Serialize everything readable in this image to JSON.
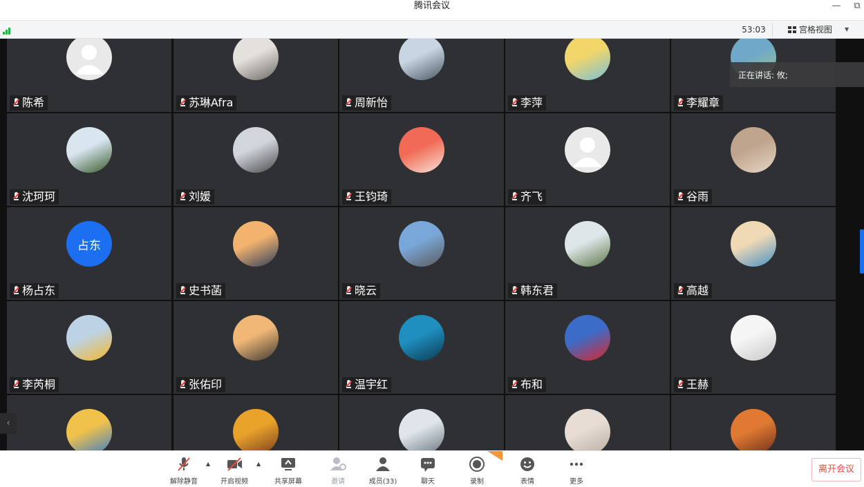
{
  "window": {
    "title": "腾讯会议",
    "minimize_icon": "minimize-icon",
    "restore_icon": "restore-icon"
  },
  "infobar": {
    "timer": "53:03",
    "view_label": "宫格视图",
    "view_icon": "grid-view-icon",
    "signal_icon": "signal-icon"
  },
  "speaking": {
    "text": "正在讲话: 攸;"
  },
  "accent_colors": {
    "blue": "#1d6ff2",
    "red": "#e74c3c",
    "green": "#27b24a",
    "badge": "#f5963b"
  },
  "participants": [
    {
      "name": "陈希",
      "avatar": "default-avatar"
    },
    {
      "name": "苏琳Afra",
      "avatar": "photo-avatar"
    },
    {
      "name": "周新怡",
      "avatar": "photo-avatar"
    },
    {
      "name": "李萍",
      "avatar": "photo-avatar"
    },
    {
      "name": "李耀章",
      "avatar": "photo-avatar"
    },
    {
      "name": "沈珂珂",
      "avatar": "photo-avatar"
    },
    {
      "name": "刘媛",
      "avatar": "photo-avatar"
    },
    {
      "name": "王钧琦",
      "avatar": "photo-avatar"
    },
    {
      "name": "齐飞",
      "avatar": "default-avatar"
    },
    {
      "name": "谷雨",
      "avatar": "photo-avatar"
    },
    {
      "name": "杨占东",
      "avatar": "text-avatar",
      "avatar_text": "占东"
    },
    {
      "name": "史书菡",
      "avatar": "photo-avatar"
    },
    {
      "name": "晓云",
      "avatar": "photo-avatar"
    },
    {
      "name": "韩东君",
      "avatar": "photo-avatar"
    },
    {
      "name": "高越",
      "avatar": "photo-avatar"
    },
    {
      "name": "李芮桐",
      "avatar": "photo-avatar"
    },
    {
      "name": "张佑印",
      "avatar": "photo-avatar"
    },
    {
      "name": "温宇红",
      "avatar": "photo-avatar"
    },
    {
      "name": "布和",
      "avatar": "photo-avatar"
    },
    {
      "name": "王赫",
      "avatar": "photo-avatar"
    },
    {
      "name": "",
      "avatar": "photo-avatar"
    },
    {
      "name": "",
      "avatar": "photo-avatar"
    },
    {
      "name": "",
      "avatar": "photo-avatar"
    },
    {
      "name": "",
      "avatar": "photo-avatar"
    },
    {
      "name": "",
      "avatar": "photo-avatar"
    }
  ],
  "toolbar": {
    "unmute": {
      "label": "解除静音",
      "icon": "muted-mic-icon"
    },
    "start_video": {
      "label": "开启视频",
      "icon": "video-off-icon"
    },
    "share_screen": {
      "label": "共享屏幕",
      "icon": "share-screen-icon"
    },
    "invite": {
      "label": "邀请",
      "icon": "invite-icon"
    },
    "members": {
      "label": "成员(33)",
      "icon": "members-icon"
    },
    "chat": {
      "label": "聊天",
      "icon": "chat-icon"
    },
    "record": {
      "label": "录制",
      "icon": "record-icon"
    },
    "emoji": {
      "label": "表情",
      "icon": "emoji-icon"
    },
    "more": {
      "label": "更多",
      "icon": "more-icon"
    },
    "leave": {
      "label": "离开会议"
    }
  }
}
